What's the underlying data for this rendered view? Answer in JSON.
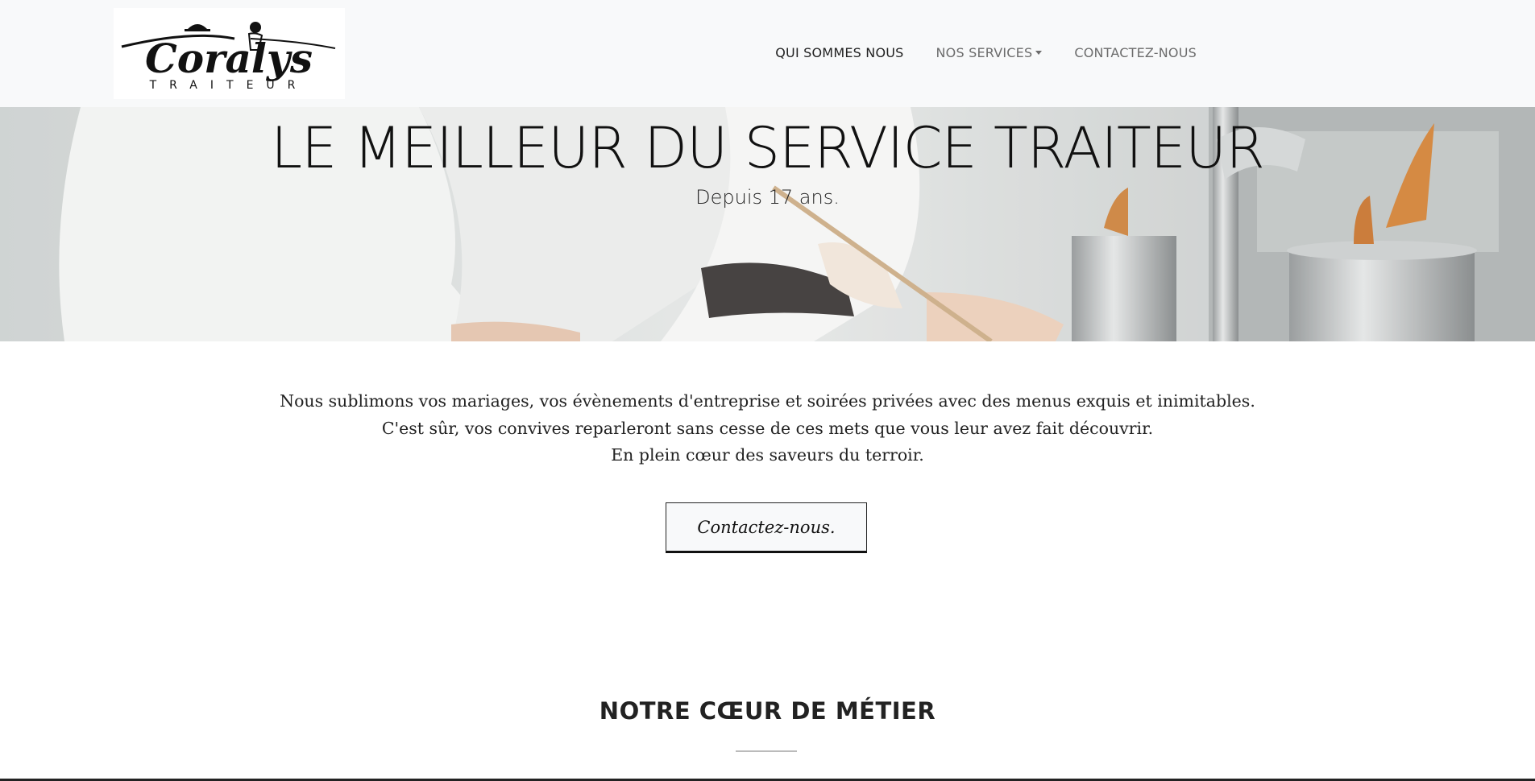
{
  "logo": {
    "name": "Coralys",
    "tagline": "TRAITEUR"
  },
  "nav": {
    "items": [
      {
        "label": "QUI SOMMES NOUS",
        "active": true
      },
      {
        "label": "NOS SERVICES",
        "dropdown": true
      },
      {
        "label": "CONTACTEZ-NOUS"
      }
    ]
  },
  "hero": {
    "title": "LE MEILLEUR DU SERVICE TRAITEUR",
    "subtitle": "Depuis 17 ans."
  },
  "intro": {
    "lines": [
      "Nous sublimons vos mariages, vos évènements d'entreprise et soirées privées avec des menus exquis et inimitables.",
      "C'est sûr, vos convives reparleront sans cesse de ces mets que vous leur avez fait découvrir.",
      "En plein cœur des saveurs du terroir."
    ]
  },
  "cta": {
    "label": "Contactez-nous."
  },
  "section": {
    "title": "NOTRE CŒUR DE MÉTIER"
  },
  "colors": {
    "navbar_bg": "#f8f9fa",
    "text": "#222222",
    "muted": "#6c6c6c"
  }
}
